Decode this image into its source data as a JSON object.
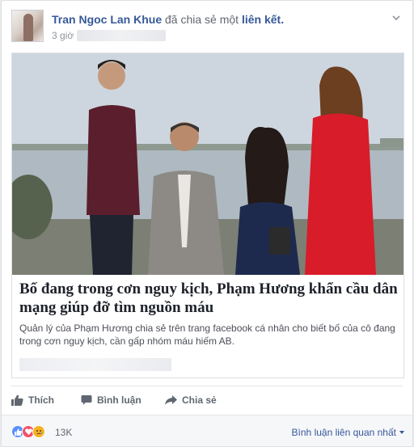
{
  "post": {
    "author": "Tran Ngoc Lan Khue",
    "verb": "đã chia sẻ một",
    "object": "liên kết.",
    "time": "3 giờ"
  },
  "card": {
    "title": "Bố đang trong cơn nguy kịch, Phạm Hương khẩn cầu dân mạng giúp đỡ tìm nguồn máu",
    "description": "Quản lý của Phạm Hương chia sẻ trên trang facebook cá nhân cho biết bố của cô đang trong cơn nguy kịch, cần gấp nhóm máu hiếm AB."
  },
  "actions": {
    "like": "Thích",
    "comment": "Bình luận",
    "share": "Chia sẻ"
  },
  "footer": {
    "reaction_count": "13K",
    "sort_label": "Bình luận liên quan nhất",
    "reactions": [
      "like-icon",
      "love-icon",
      "sad-icon"
    ]
  },
  "colors": {
    "link_blue": "#365899",
    "like_blue": "#5890ff",
    "love_red": "#f25268",
    "sad_yellow": "#f7b125"
  }
}
